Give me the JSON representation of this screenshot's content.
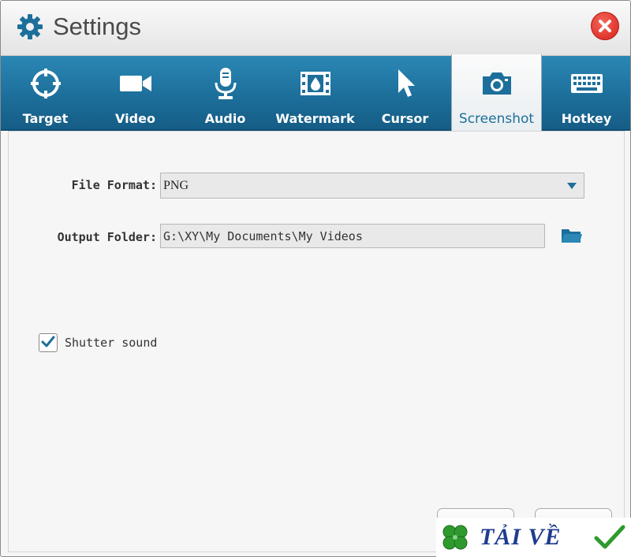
{
  "window": {
    "title": "Settings"
  },
  "tabs": [
    {
      "label": "Target",
      "icon": "crosshair-icon"
    },
    {
      "label": "Video",
      "icon": "video-camera-icon"
    },
    {
      "label": "Audio",
      "icon": "microphone-icon"
    },
    {
      "label": "Watermark",
      "icon": "film-watermark-icon"
    },
    {
      "label": "Cursor",
      "icon": "cursor-arrow-icon"
    },
    {
      "label": "Screenshot",
      "icon": "camera-icon",
      "active": true
    },
    {
      "label": "Hotkey",
      "icon": "keyboard-icon"
    }
  ],
  "form": {
    "file_format_label": "File Format:",
    "file_format_value": "PNG",
    "output_folder_label": "Output Folder:",
    "output_folder_value": "G:\\XY\\My Documents\\My Videos",
    "shutter_sound_label": "Shutter sound",
    "shutter_sound_checked": true
  },
  "watermark": {
    "text": "TẢI VỀ"
  },
  "colors": {
    "tabbar": "#1d6f9b",
    "active_tab_text": "#1d6f9b",
    "close_button": "#d8221a",
    "checkmark": "#1d6f9b"
  }
}
